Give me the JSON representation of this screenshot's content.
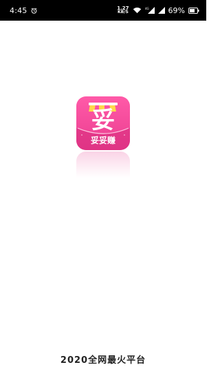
{
  "status_bar": {
    "time": "4:45",
    "net_speed_value": "1.27",
    "net_speed_unit": "KB/S",
    "network_type": "4G",
    "battery_percent": "69%"
  },
  "splash": {
    "app_icon": {
      "brand_text": "妥妥赚",
      "glyph": "妥",
      "colors": {
        "background": "#ea3d8f",
        "accent": "#ffd84a",
        "text": "#ffffff"
      }
    },
    "slogan": "2020全网最火平台"
  }
}
